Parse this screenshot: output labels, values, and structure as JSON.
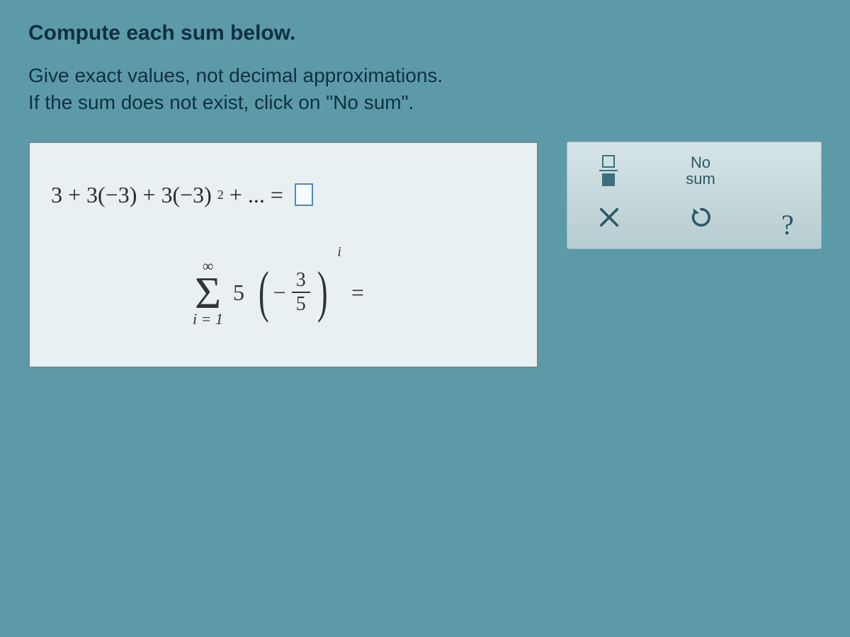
{
  "heading": "Compute each sum below.",
  "instructions_line1": "Give exact values, not decimal approximations.",
  "instructions_line2": "If the sum does not exist, click on \"No sum\".",
  "problems": {
    "p1": {
      "expression_prefix": "3 + 3(−3) + 3(−3)",
      "exponent": "2",
      "expression_suffix": " + ... =",
      "answer": ""
    },
    "p2": {
      "sigma_upper": "∞",
      "sigma_symbol": "Σ",
      "sigma_lower": "i = 1",
      "coefficient": "5",
      "frac_sign": "−",
      "frac_num": "3",
      "frac_den": "5",
      "power": "i",
      "equals": "=",
      "answer": ""
    }
  },
  "keypad": {
    "fraction_tool": "fraction",
    "no_sum_line1": "No",
    "no_sum_line2": "sum",
    "clear": "×",
    "reset": "↺",
    "help": "?"
  }
}
